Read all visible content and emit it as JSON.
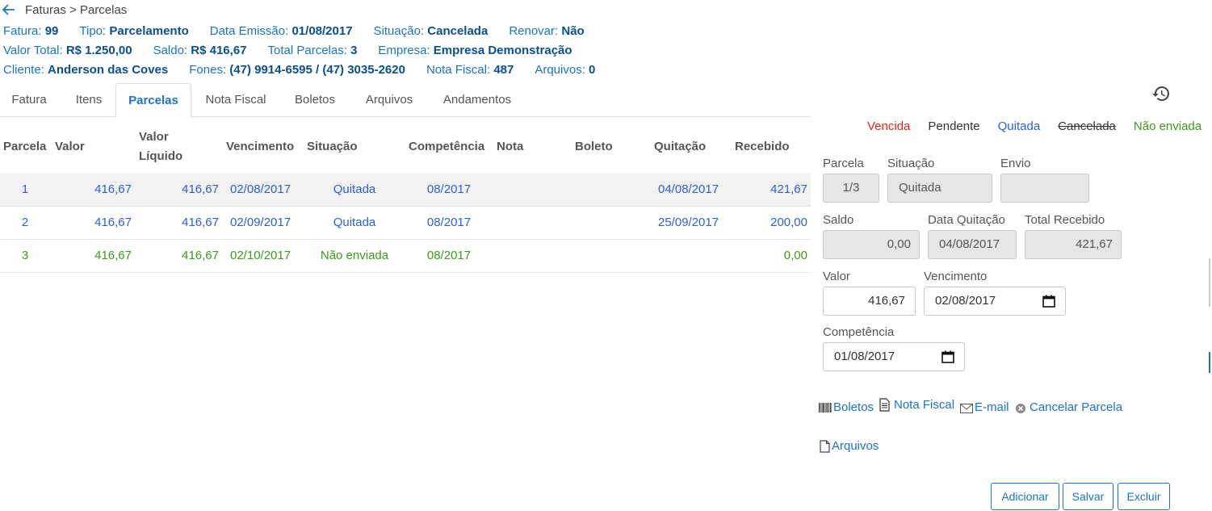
{
  "breadcrumb": {
    "text": "Faturas > Parcelas"
  },
  "header": {
    "fatura": {
      "label": "Fatura:",
      "value": "99"
    },
    "tipo": {
      "label": "Tipo:",
      "value": "Parcelamento"
    },
    "data_emissao": {
      "label": "Data Emissão:",
      "value": "01/08/2017"
    },
    "situacao": {
      "label": "Situação:",
      "value": "Cancelada"
    },
    "renovar": {
      "label": "Renovar:",
      "value": "Não"
    },
    "valor_total": {
      "label": "Valor Total:",
      "value": "R$ 1.250,00"
    },
    "saldo": {
      "label": "Saldo:",
      "value": "R$ 416,67"
    },
    "total_parcelas": {
      "label": "Total Parcelas:",
      "value": "3"
    },
    "empresa": {
      "label": "Empresa:",
      "value": "Empresa Demonstração"
    },
    "cliente": {
      "label": "Cliente:",
      "value": "Anderson das Coves"
    },
    "fones": {
      "label": "Fones:",
      "value": "(47) 9914-6595 / (47) 3035-2620"
    },
    "nota_fiscal": {
      "label": "Nota Fiscal:",
      "value": "487"
    },
    "arquivos": {
      "label": "Arquivos:",
      "value": "0"
    }
  },
  "tabs": [
    "Fatura",
    "Itens",
    "Parcelas",
    "Nota Fiscal",
    "Boletos",
    "Arquivos",
    "Andamentos"
  ],
  "active_tab": "Parcelas",
  "table": {
    "columns": [
      "Parcela",
      "Valor",
      "Valor Líquido",
      "Vencimento",
      "Situação",
      "Competência",
      "Nota",
      "Boleto",
      "Quitação",
      "Recebido"
    ],
    "column_valor_liquido_line1": "Valor",
    "column_valor_liquido_line2": "Líquido",
    "rows": [
      {
        "parcela": "1",
        "valor": "416,67",
        "valor_liquido": "416,67",
        "vencimento": "02/08/2017",
        "situacao": "Quitada",
        "competencia": "08/2017",
        "nota": "",
        "boleto": "",
        "quitacao": "04/08/2017",
        "recebido": "421,67"
      },
      {
        "parcela": "2",
        "valor": "416,67",
        "valor_liquido": "416,67",
        "vencimento": "02/09/2017",
        "situacao": "Quitada",
        "competencia": "08/2017",
        "nota": "",
        "boleto": "",
        "quitacao": "25/09/2017",
        "recebido": "200,00"
      },
      {
        "parcela": "3",
        "valor": "416,67",
        "valor_liquido": "416,67",
        "vencimento": "02/10/2017",
        "situacao": "Não enviada",
        "competencia": "08/2017",
        "nota": "",
        "boleto": "",
        "quitacao": "",
        "recebido": "0,00"
      }
    ]
  },
  "legend": {
    "vencida": "Vencida",
    "pendente": "Pendente",
    "quitada": "Quitada",
    "cancelada": "Cancelada",
    "nao_enviada": "Não enviada"
  },
  "colors": {
    "vencida": "#e02020",
    "quitada": "#2e5fd8",
    "nao_enviada": "#3d9a1a",
    "accent": "#1a73c8"
  },
  "form": {
    "parcela": {
      "label": "Parcela",
      "value": "1/3"
    },
    "situacao": {
      "label": "Situação",
      "value": "Quitada"
    },
    "envio": {
      "label": "Envio",
      "value": ""
    },
    "saldo": {
      "label": "Saldo",
      "value": "0,00"
    },
    "data_quitacao": {
      "label": "Data Quitação",
      "value": "04/08/2017"
    },
    "total_recebido": {
      "label": "Total Recebido",
      "value": "421,67"
    },
    "valor": {
      "label": "Valor",
      "value": "416,67"
    },
    "vencimento": {
      "label": "Vencimento",
      "value": "02/08/2017"
    },
    "competencia": {
      "label": "Competência",
      "value": "01/08/2017"
    }
  },
  "actions": {
    "boletos": "Boletos",
    "nota_fiscal": "Nota Fiscal",
    "email": "E-mail",
    "cancelar_parcela": "Cancelar Parcela",
    "arquivos": "Arquivos"
  },
  "buttons": {
    "adicionar": "Adicionar",
    "salvar": "Salvar",
    "excluir": "Excluir"
  },
  "icons": [
    "back-arrow-icon",
    "history-icon",
    "barcode-icon",
    "document-icon",
    "envelope-icon",
    "cancel-circle-icon",
    "file-icon",
    "calendar-icon"
  ]
}
